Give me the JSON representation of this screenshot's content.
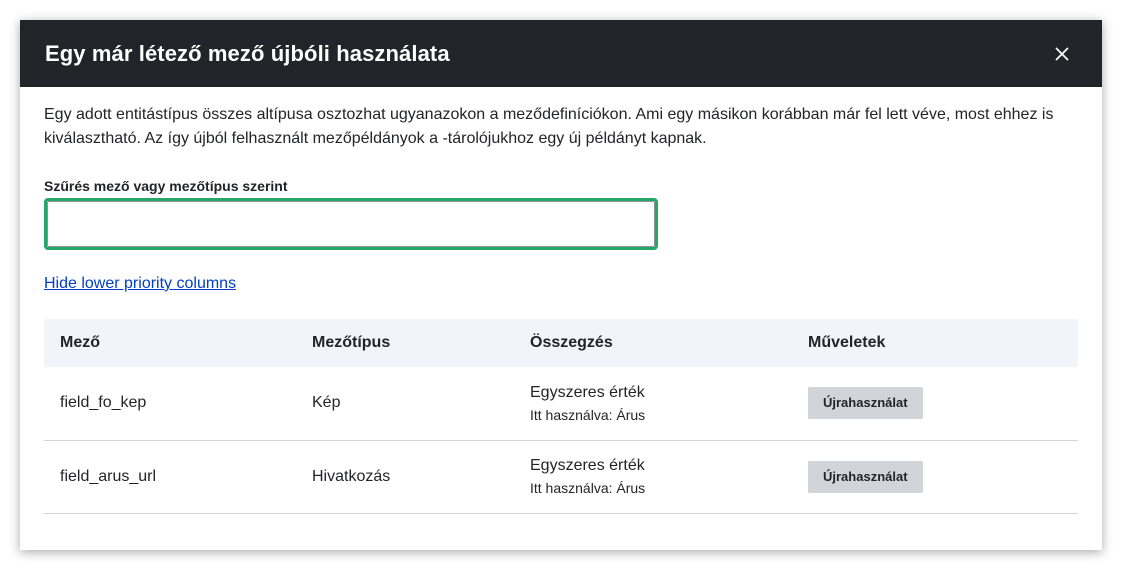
{
  "dialog": {
    "title": "Egy már létező mező újbóli használata",
    "close_icon": "close-icon",
    "description": "Egy adott entitástípus összes altípusa osztozhat ugyanazokon a meződefiníciókon. Ami egy másikon korábban már fel lett véve, most ehhez is kiválasztható. Az így újból felhasznált mezőpéldányok a -tárolójukhoz egy új példányt kapnak.",
    "filter": {
      "label": "Szűrés mező vagy mezőtípus szerint",
      "value": "",
      "placeholder": ""
    },
    "toggle_link": "Hide lower priority columns",
    "table": {
      "headers": [
        "Mező",
        "Mezőtípus",
        "Összegzés",
        "Műveletek"
      ],
      "rows": [
        {
          "field": "field_fo_kep",
          "type": "Kép",
          "summary_main": "Egyszeres érték",
          "summary_sub": "Itt használva: Árus",
          "action": "Újrahasználat"
        },
        {
          "field": "field_arus_url",
          "type": "Hivatkozás",
          "summary_main": "Egyszeres érték",
          "summary_sub": "Itt használva: Árus",
          "action": "Újrahasználat"
        }
      ]
    }
  },
  "colors": {
    "titlebar_bg": "#232429",
    "focus_border": "#26a769",
    "link": "#003ecc",
    "header_row_bg": "#f3f4f9",
    "button_bg": "#d3d4d9"
  }
}
